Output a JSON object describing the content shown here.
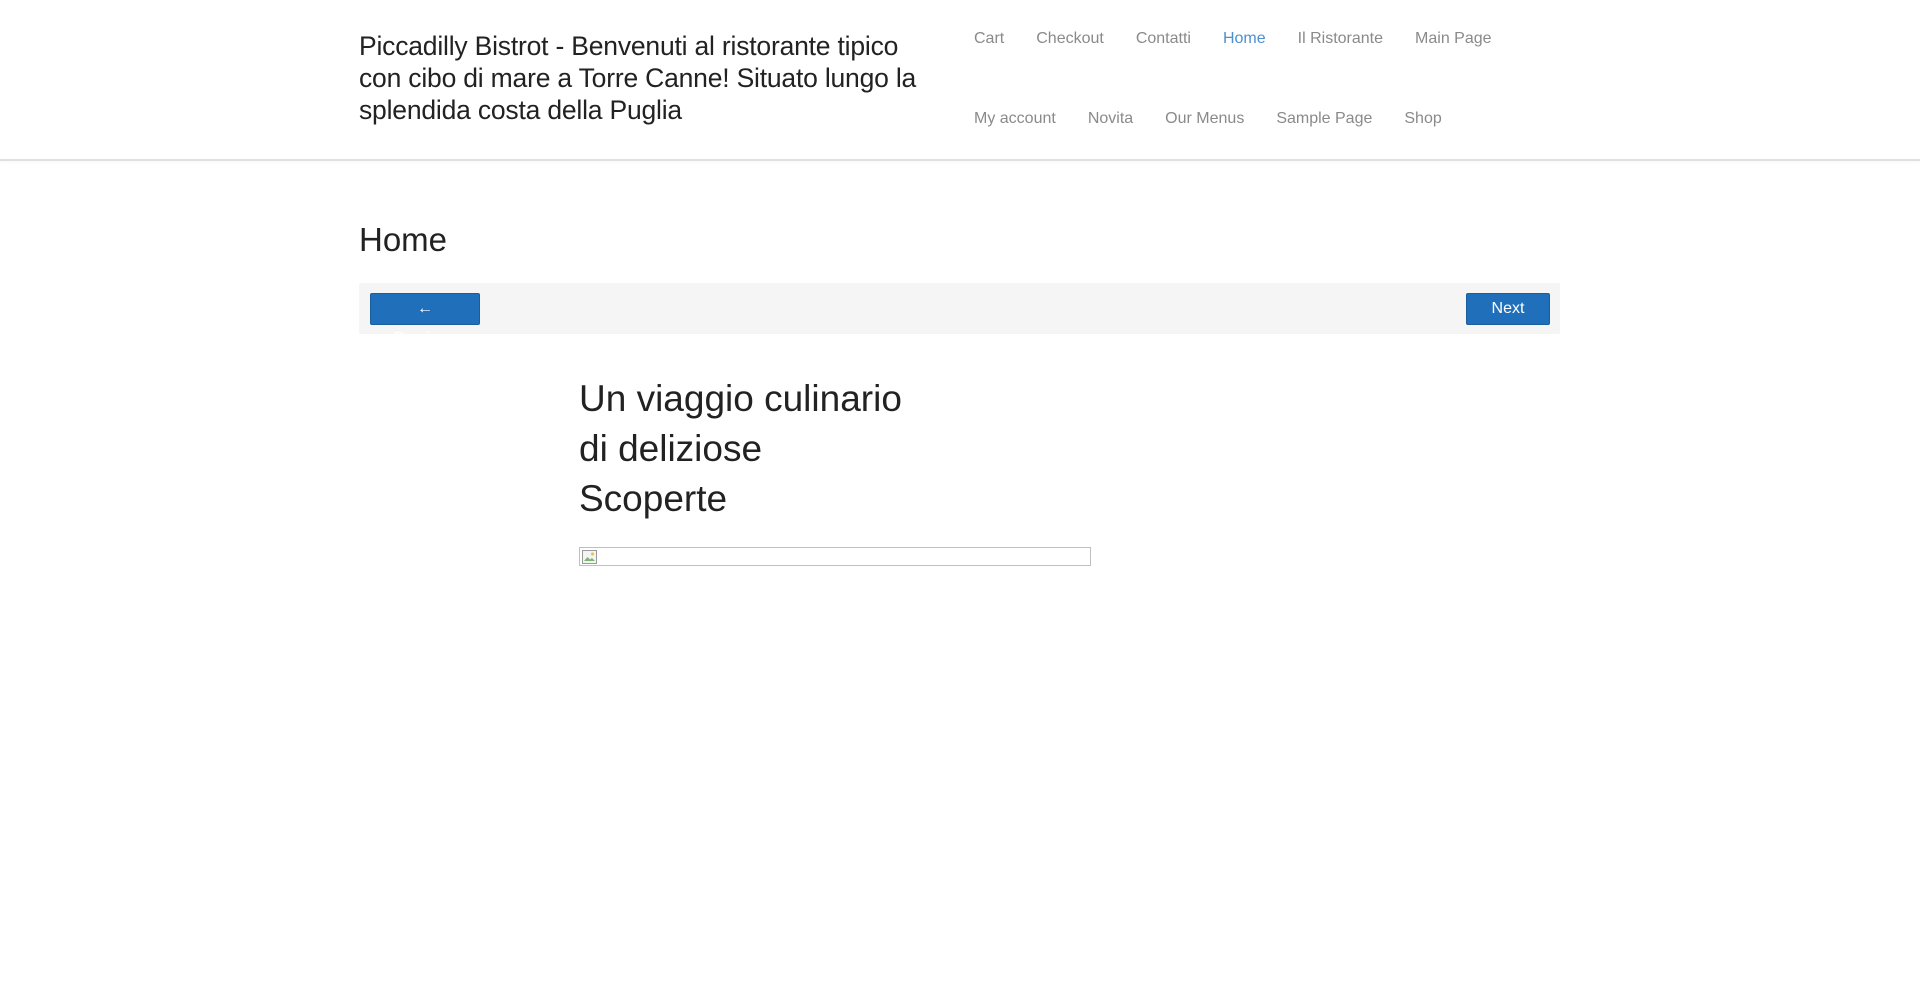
{
  "header": {
    "site_title": "Piccadilly Bistrot - Benvenuti al ristorante tipico con cibo di mare a Torre Canne! Situato lungo la splendida costa della Puglia"
  },
  "nav": {
    "row1": [
      {
        "label": "Cart"
      },
      {
        "label": "Checkout"
      },
      {
        "label": "Contatti"
      },
      {
        "label": "Home",
        "active": true
      },
      {
        "label": "Il Ristorante"
      },
      {
        "label": "Main Page"
      }
    ],
    "row2": [
      {
        "label": "My account"
      },
      {
        "label": "Novita"
      },
      {
        "label": "Our Menus"
      },
      {
        "label": "Sample Page"
      },
      {
        "label": "Shop"
      }
    ],
    "active_color": "#4f8fcd",
    "text_color": "#8a8a8a"
  },
  "page": {
    "title": "Home"
  },
  "post_nav": {
    "previous_label": "← Previous",
    "next_label": "Next →",
    "button_color": "#1f6fba"
  },
  "content": {
    "heading_lines": [
      "Un viaggio culinario",
      "di deliziose",
      "Scoperte"
    ],
    "image_icon": "broken-image-icon"
  }
}
